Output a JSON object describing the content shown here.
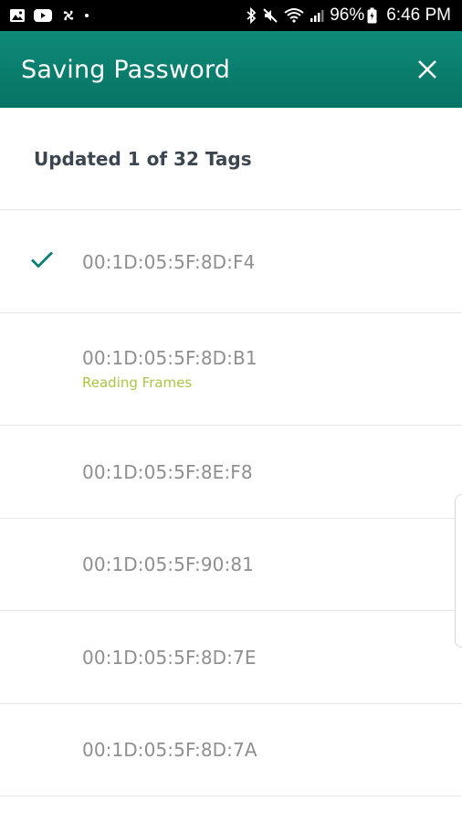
{
  "status_bar": {
    "battery": "96%",
    "time": "6:46 PM",
    "left_icons": [
      "gallery-icon",
      "youtube-icon",
      "pinwheel-icon",
      "dot-icon"
    ],
    "right_icons": [
      "bluetooth-icon",
      "mute-icon",
      "wifi-icon",
      "signal-icon",
      "battery-icon"
    ]
  },
  "app_bar": {
    "title": "Saving Password",
    "close_icon": "close-icon",
    "color": "#0b7f6f"
  },
  "progress": {
    "text": "Updated 1 of 32 Tags"
  },
  "tags": [
    {
      "address": "00:1D:05:5F:8D:F4",
      "status": "",
      "done": true
    },
    {
      "address": "00:1D:05:5F:8D:B1",
      "status": "Reading Frames",
      "done": false
    },
    {
      "address": "00:1D:05:5F:8E:F8",
      "status": "",
      "done": false
    },
    {
      "address": "00:1D:05:5F:90:81",
      "status": "",
      "done": false
    },
    {
      "address": "00:1D:05:5F:8D:7E",
      "status": "",
      "done": false
    },
    {
      "address": "00:1D:05:5F:8D:7A",
      "status": "",
      "done": false
    }
  ],
  "colors": {
    "accent": "#0b7f6f",
    "status_text": "#a9c744",
    "check": "#0b7f6f"
  }
}
